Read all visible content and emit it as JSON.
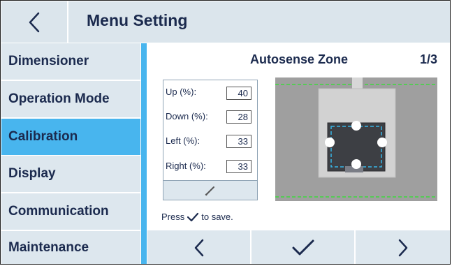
{
  "header": {
    "back_icon": "chevron-left-icon",
    "title": "Menu Setting"
  },
  "sidebar": {
    "items": [
      {
        "label": "Dimensioner",
        "active": false
      },
      {
        "label": "Operation Mode",
        "active": false
      },
      {
        "label": "Calibration",
        "active": true
      },
      {
        "label": "Display",
        "active": false
      },
      {
        "label": "Communication",
        "active": false
      },
      {
        "label": "Maintenance",
        "active": false
      }
    ]
  },
  "main": {
    "title": "Autosense Zone",
    "page": "1/3",
    "fields": [
      {
        "label": "Up (%):",
        "value": "40"
      },
      {
        "label": "Down (%):",
        "value": "28"
      },
      {
        "label": "Left (%):",
        "value": "33"
      },
      {
        "label": "Right (%):",
        "value": "33"
      }
    ],
    "edit_icon": "pencil-icon",
    "hint_before": "Press",
    "hint_after": "to save.",
    "hint_icon": "check-icon"
  },
  "bottom_nav": {
    "icons": [
      "chevron-left-icon",
      "check-icon",
      "chevron-right-icon"
    ]
  },
  "colors": {
    "accent": "#48b5ee",
    "panel": "#dde7ee",
    "text": "#1b2a4e",
    "zone_outline": "#38b6e6",
    "guide_line": "#3ed83e"
  }
}
